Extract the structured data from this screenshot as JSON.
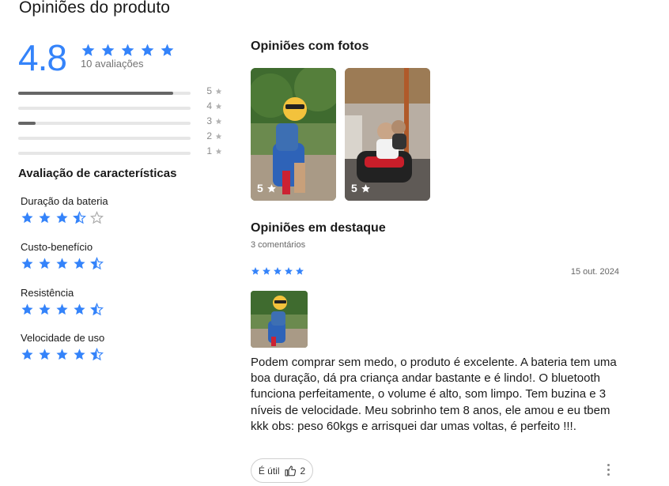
{
  "page": {
    "title": "Opiniões do produto"
  },
  "summary": {
    "score": "4.8",
    "stars": 5,
    "review_count": "10 avaliações",
    "accent_color": "#3483fa"
  },
  "distribution": [
    {
      "label": "5",
      "fraction": 0.9
    },
    {
      "label": "4",
      "fraction": 0.0
    },
    {
      "label": "3",
      "fraction": 0.1
    },
    {
      "label": "2",
      "fraction": 0.0
    },
    {
      "label": "1",
      "fraction": 0.0
    }
  ],
  "features": {
    "title": "Avaliação de características",
    "items": [
      {
        "label": "Duração da bateria",
        "rating": 3.5
      },
      {
        "label": "Custo-benefício",
        "rating": 4.5
      },
      {
        "label": "Resistência",
        "rating": 4.5
      },
      {
        "label": "Velocidade de uso",
        "rating": 4.5
      }
    ]
  },
  "photos_section": {
    "title": "Opiniões com fotos",
    "photos": [
      {
        "rating": "5",
        "icon": "star-icon"
      },
      {
        "rating": "5",
        "icon": "star-icon"
      }
    ]
  },
  "featured": {
    "title": "Opiniões em destaque",
    "comments_count": "3 comentários",
    "review": {
      "stars": 5,
      "date": "15 out. 2024",
      "text": "Podem comprar sem medo, o produto é excelente. A bateria tem uma boa duração, dá pra criança andar bastante e é lindo!. O bluetooth funciona perfeitamente, o volume é alto, som limpo. Tem buzina e 3 níveis de velocidade. Meu sobrinho tem 8 anos, ele amou e eu tbem kkk obs: peso 60kgs e arrisquei dar umas voltas, é perfeito !!!.",
      "useful_label": "É útil",
      "useful_count": "2"
    }
  }
}
